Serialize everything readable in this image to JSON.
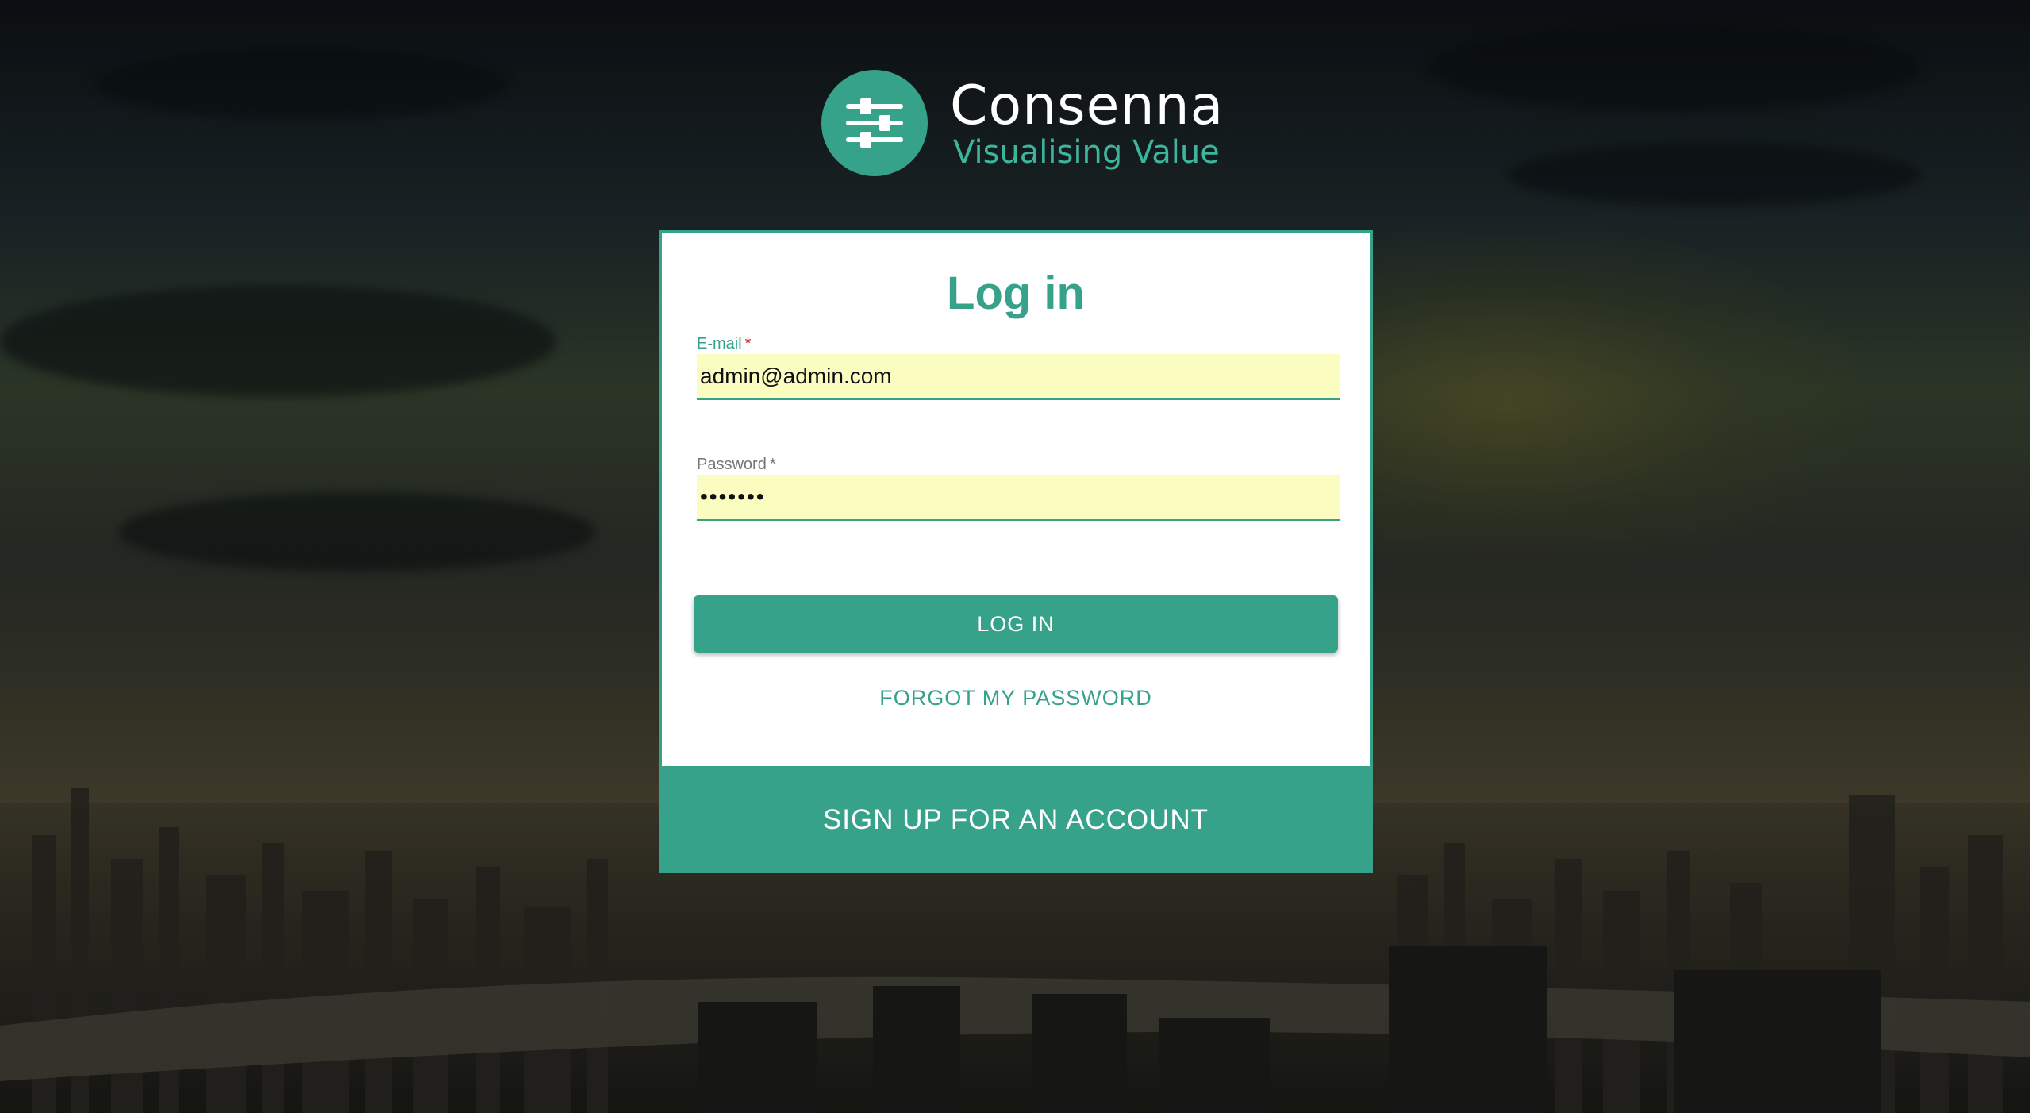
{
  "brand": {
    "name": "Consenna",
    "tagline": "Visualising Value",
    "logo_icon": "sliders-icon",
    "accent_color": "#36a28a"
  },
  "login_form": {
    "title": "Log in",
    "email": {
      "label": "E-mail",
      "required_mark": "*",
      "value": "admin@admin.com"
    },
    "password": {
      "label": "Password",
      "required_mark": "*",
      "value": "•••••••"
    },
    "login_button": "LOG IN",
    "forgot_link": "FORGOT MY PASSWORD",
    "signup_button": "SIGN UP FOR AN ACCOUNT"
  }
}
